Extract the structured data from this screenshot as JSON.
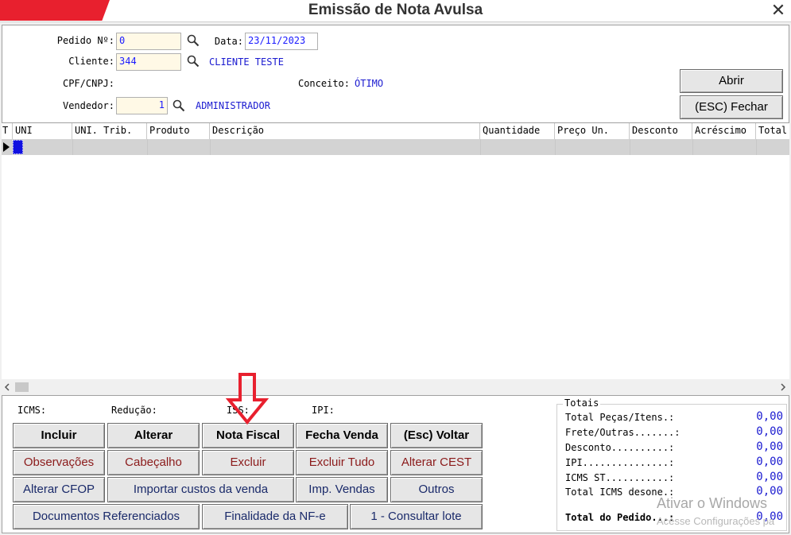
{
  "window": {
    "title": "Emissão de Nota Avulsa",
    "close_glyph": "✕"
  },
  "header": {
    "pedido_label": "Pedido Nº:",
    "pedido_value": "0",
    "data_label": "Data:",
    "data_value": "23/11/2023",
    "cliente_label": "Cliente:",
    "cliente_value": "344",
    "cliente_name": "CLIENTE TESTE",
    "cpf_label": "CPF/CNPJ:",
    "conceito_label": "Conceito:",
    "conceito_value": "ÓTIMO",
    "vendedor_label": "Vendedor:",
    "vendedor_value": "1",
    "vendedor_name": "ADMINISTRADOR",
    "abrir_label": "Abrir",
    "fechar_label": "(ESC) Fechar"
  },
  "grid": {
    "columns": [
      "T",
      "UNI",
      "UNI. Trib.",
      "Produto",
      "Descrição",
      "Quantidade",
      "Preço Un.",
      "Desconto",
      "Acréscimo",
      "Total"
    ]
  },
  "taxes": {
    "icms": "ICMS:",
    "reducao": "Redução:",
    "iss": "ISS:",
    "ipi": "IPI:"
  },
  "buttons": {
    "incluir": "Incluir",
    "alterar": "Alterar",
    "nota_fiscal": "Nota Fiscal",
    "fecha_venda": "Fecha Venda",
    "voltar": "(Esc) Voltar",
    "observacoes": "Observações",
    "cabecalho": "Cabeçalho",
    "excluir": "Excluir",
    "excluir_tudo": "Excluir Tudo",
    "alterar_cest": "Alterar CEST",
    "alterar_cfop": "Alterar CFOP",
    "importar_custos": "Importar custos da venda",
    "imp_vendas": "Imp. Vendas",
    "outros": "Outros",
    "documentos_referenciados": "Documentos Referenciados",
    "finalidade_nfe": "Finalidade da NF-e",
    "consultar_lote": "1 - Consultar lote"
  },
  "totals": {
    "title": "Totais",
    "rows": [
      {
        "label": "Total Peças/Itens.:",
        "value": "0,00"
      },
      {
        "label": "Frete/Outras.......:",
        "value": "0,00"
      },
      {
        "label": "Desconto..........:",
        "value": "0,00"
      },
      {
        "label": "IPI...............:",
        "value": "0,00"
      },
      {
        "label": "ICMS ST...........:",
        "value": "0,00"
      },
      {
        "label": "Total ICMS desone.:",
        "value": "0,00"
      }
    ],
    "pedido_label": "Total do Pedido...:",
    "pedido_value": "0,00"
  },
  "watermark": {
    "line1": "Ativar o Windows",
    "line2": "Acesse Configurações pa"
  },
  "colors": {
    "accent_red": "#e8202e",
    "value_blue": "#1a1ad0",
    "field_bg": "#fff9e6",
    "annotation_arrow": "#e8202e"
  }
}
